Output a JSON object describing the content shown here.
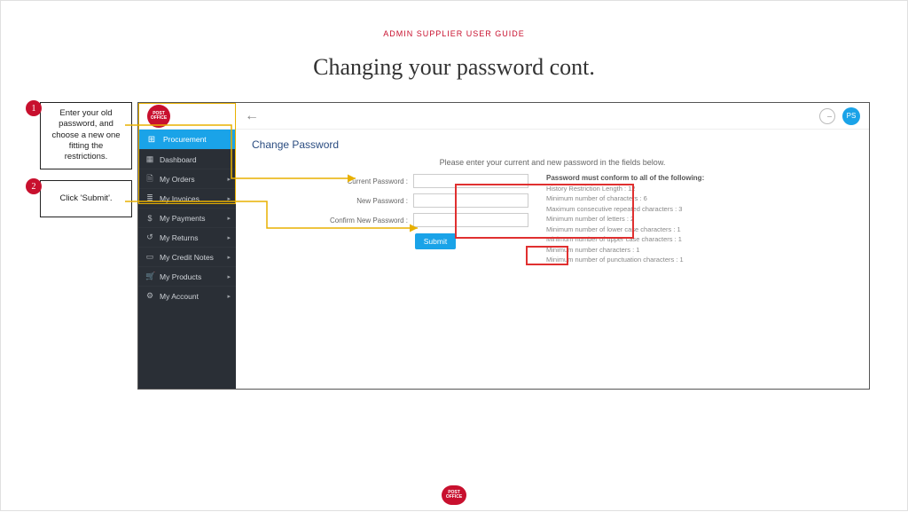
{
  "doc": {
    "header": "ADMIN SUPPLIER USER GUIDE",
    "title": "Changing your password cont."
  },
  "callouts": {
    "c1_num": "1",
    "c1_text": "Enter your old password, and choose a new one fitting the restrictions.",
    "c2_num": "2",
    "c2_text": "Click 'Submit'."
  },
  "topbar": {
    "logo_text": "POST OFFICE",
    "avatar": "PS"
  },
  "sidebar": {
    "active": "Procurement",
    "items": [
      "Dashboard",
      "My Orders",
      "My Invoices",
      "My Payments",
      "My Returns",
      "My Credit Notes",
      "My Products",
      "My Account"
    ]
  },
  "main": {
    "title": "Change Password",
    "prompt": "Please enter your current and new password in the fields below.",
    "labels": {
      "current": "Current Password  :",
      "new": "New Password  :",
      "confirm": "Confirm New Password  :"
    },
    "submit": "Submit"
  },
  "rules": {
    "title": "Password must conform to all of the following:",
    "list": [
      "History Restriction Length  : 12",
      "Minimum number of characters  : 6",
      "Maximum consecutive repeated characters  : 3",
      "Minimum number of letters  : 2",
      "Minimum number of lower case characters  : 1",
      "Minimum number of upper case characters  : 1",
      "Minimum number characters  : 1",
      "Minimum number of punctuation characters  : 1"
    ]
  },
  "footer": {
    "logo_text": "POST OFFICE"
  }
}
